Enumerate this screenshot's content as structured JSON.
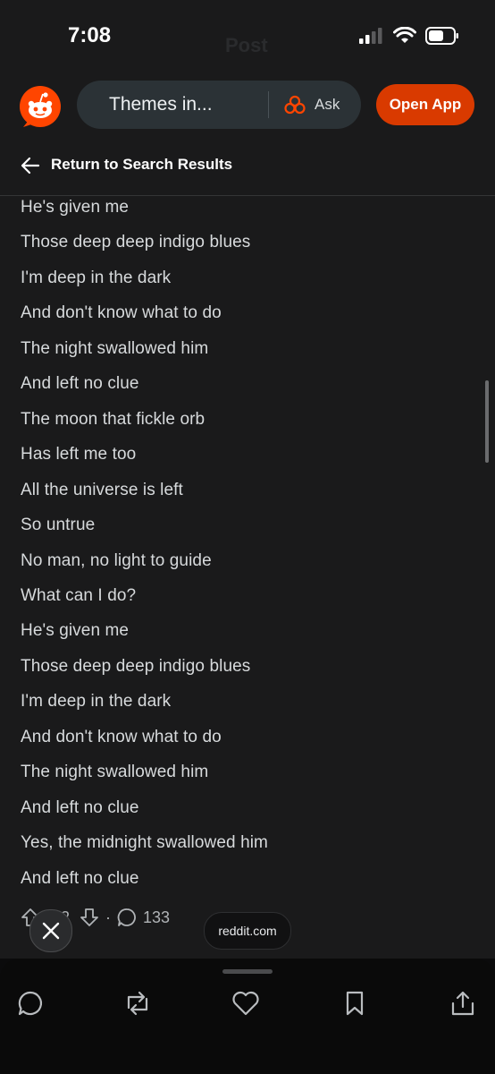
{
  "status_bar": {
    "time": "7:08",
    "ghost_title": "Post"
  },
  "nav": {
    "search_text": "Themes in...",
    "ask_label": "Ask",
    "open_app_label": "Open App",
    "accent_color": "#d93a00"
  },
  "sub_header": {
    "return_label": "Return to Search Results"
  },
  "lyrics": [
    "He's given me",
    "Those deep deep indigo blues",
    "I'm deep in the dark",
    "And don't know what to do",
    "The night swallowed him",
    "And left no clue",
    "The moon that fickle orb",
    "Has left me too",
    "All the universe is left",
    "So untrue",
    "No man, no light to guide",
    "What can I do?",
    "He's given me",
    "Those deep deep indigo blues",
    "I'm deep in the dark",
    "And don't know what to do",
    "The night swallowed him",
    "And left no clue",
    "Yes, the midnight swallowed him",
    "And left no clue"
  ],
  "actions": {
    "vote_count": "72",
    "comment_count": "133"
  },
  "browser": {
    "domain": "reddit.com"
  },
  "bottom_bar_icons": [
    "reply-icon",
    "repost-icon",
    "like-icon",
    "bookmark-icon",
    "share-icon"
  ]
}
